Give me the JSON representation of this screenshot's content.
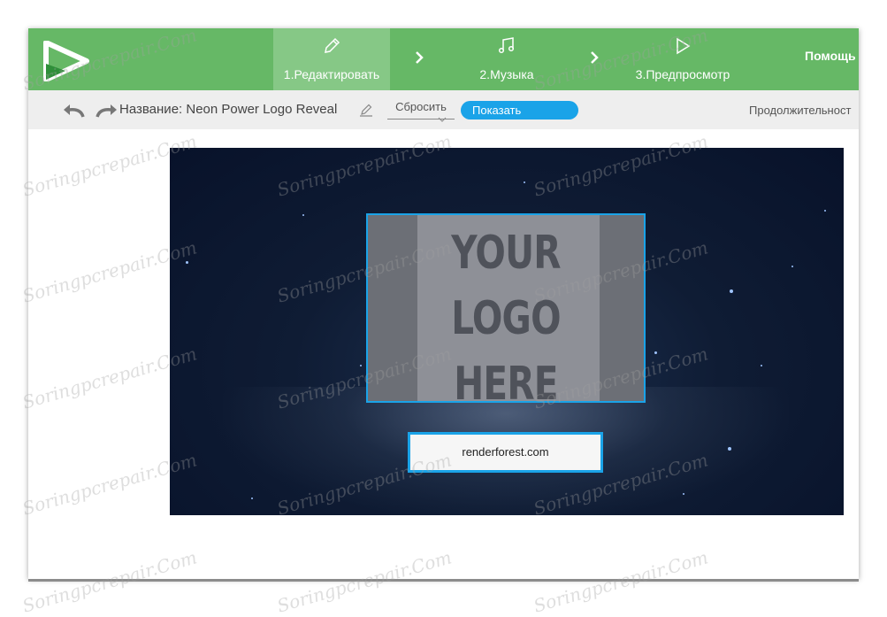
{
  "header": {
    "steps": [
      {
        "label": "1.Редактировать",
        "icon": "pencil-icon",
        "active": true
      },
      {
        "label": "2.Музыка",
        "icon": "music-note-icon",
        "active": false
      },
      {
        "label": "3.Предпросмотр",
        "icon": "play-icon",
        "active": false
      }
    ],
    "help_label": "Помощь"
  },
  "toolbar": {
    "title_label": "Название: Neon Power Logo Reveal",
    "reset_label": "Сбросить",
    "show_label": "Показать",
    "duration_label": "Продолжительност"
  },
  "preview": {
    "logo_placeholder": [
      "YOUR",
      "LOGO",
      "HERE"
    ],
    "url_text": "renderforest.com"
  },
  "watermark": "Soringpcrepair.Com",
  "colors": {
    "header_green": "#66b866",
    "active_step": "#86c886",
    "accent_blue": "#1aa3e8"
  }
}
